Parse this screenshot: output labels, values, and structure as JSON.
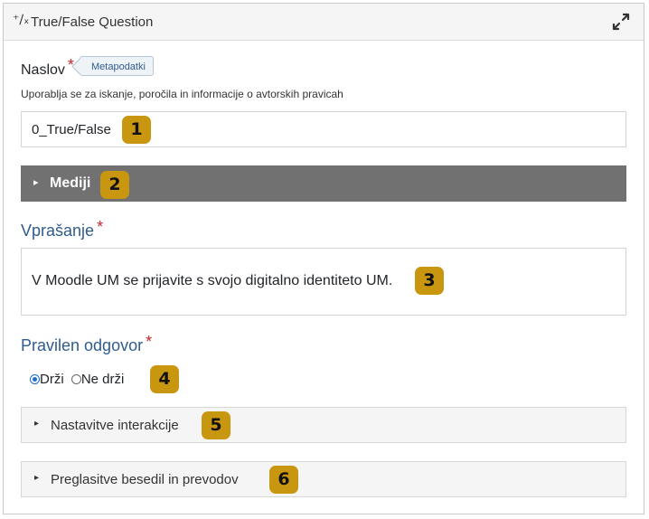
{
  "header": {
    "icon": "⁺∕ₓ",
    "title": "True/False Question"
  },
  "title_field": {
    "label": "Naslov",
    "required_mark": "*",
    "meta_tag": "Metapodatki",
    "help": "Uporablja se za iskanje, poročila in informacije o avtorskih pravicah",
    "value": "0_True/False"
  },
  "media": {
    "caret": "▸",
    "label": "Mediji"
  },
  "question": {
    "label": "Vprašanje",
    "required_mark": "*",
    "text": "V Moodle UM se prijavite s svojo digitalno identiteto UM."
  },
  "answer": {
    "label": "Pravilen odgovor",
    "required_mark": "*",
    "options": [
      {
        "label": "Drži",
        "selected": true
      },
      {
        "label": "Ne drži",
        "selected": false
      }
    ]
  },
  "sections": [
    {
      "caret": "▸",
      "label": "Nastavitve interakcije"
    },
    {
      "caret": "▸",
      "label": "Preglasitve besedil in prevodov"
    }
  ],
  "badges": [
    "1",
    "2",
    "3",
    "4",
    "5",
    "6"
  ],
  "colors": {
    "badge": "#c8960f",
    "media_bar": "#717171",
    "required": "#c0272d",
    "heading_blue": "#2f5c8c"
  }
}
